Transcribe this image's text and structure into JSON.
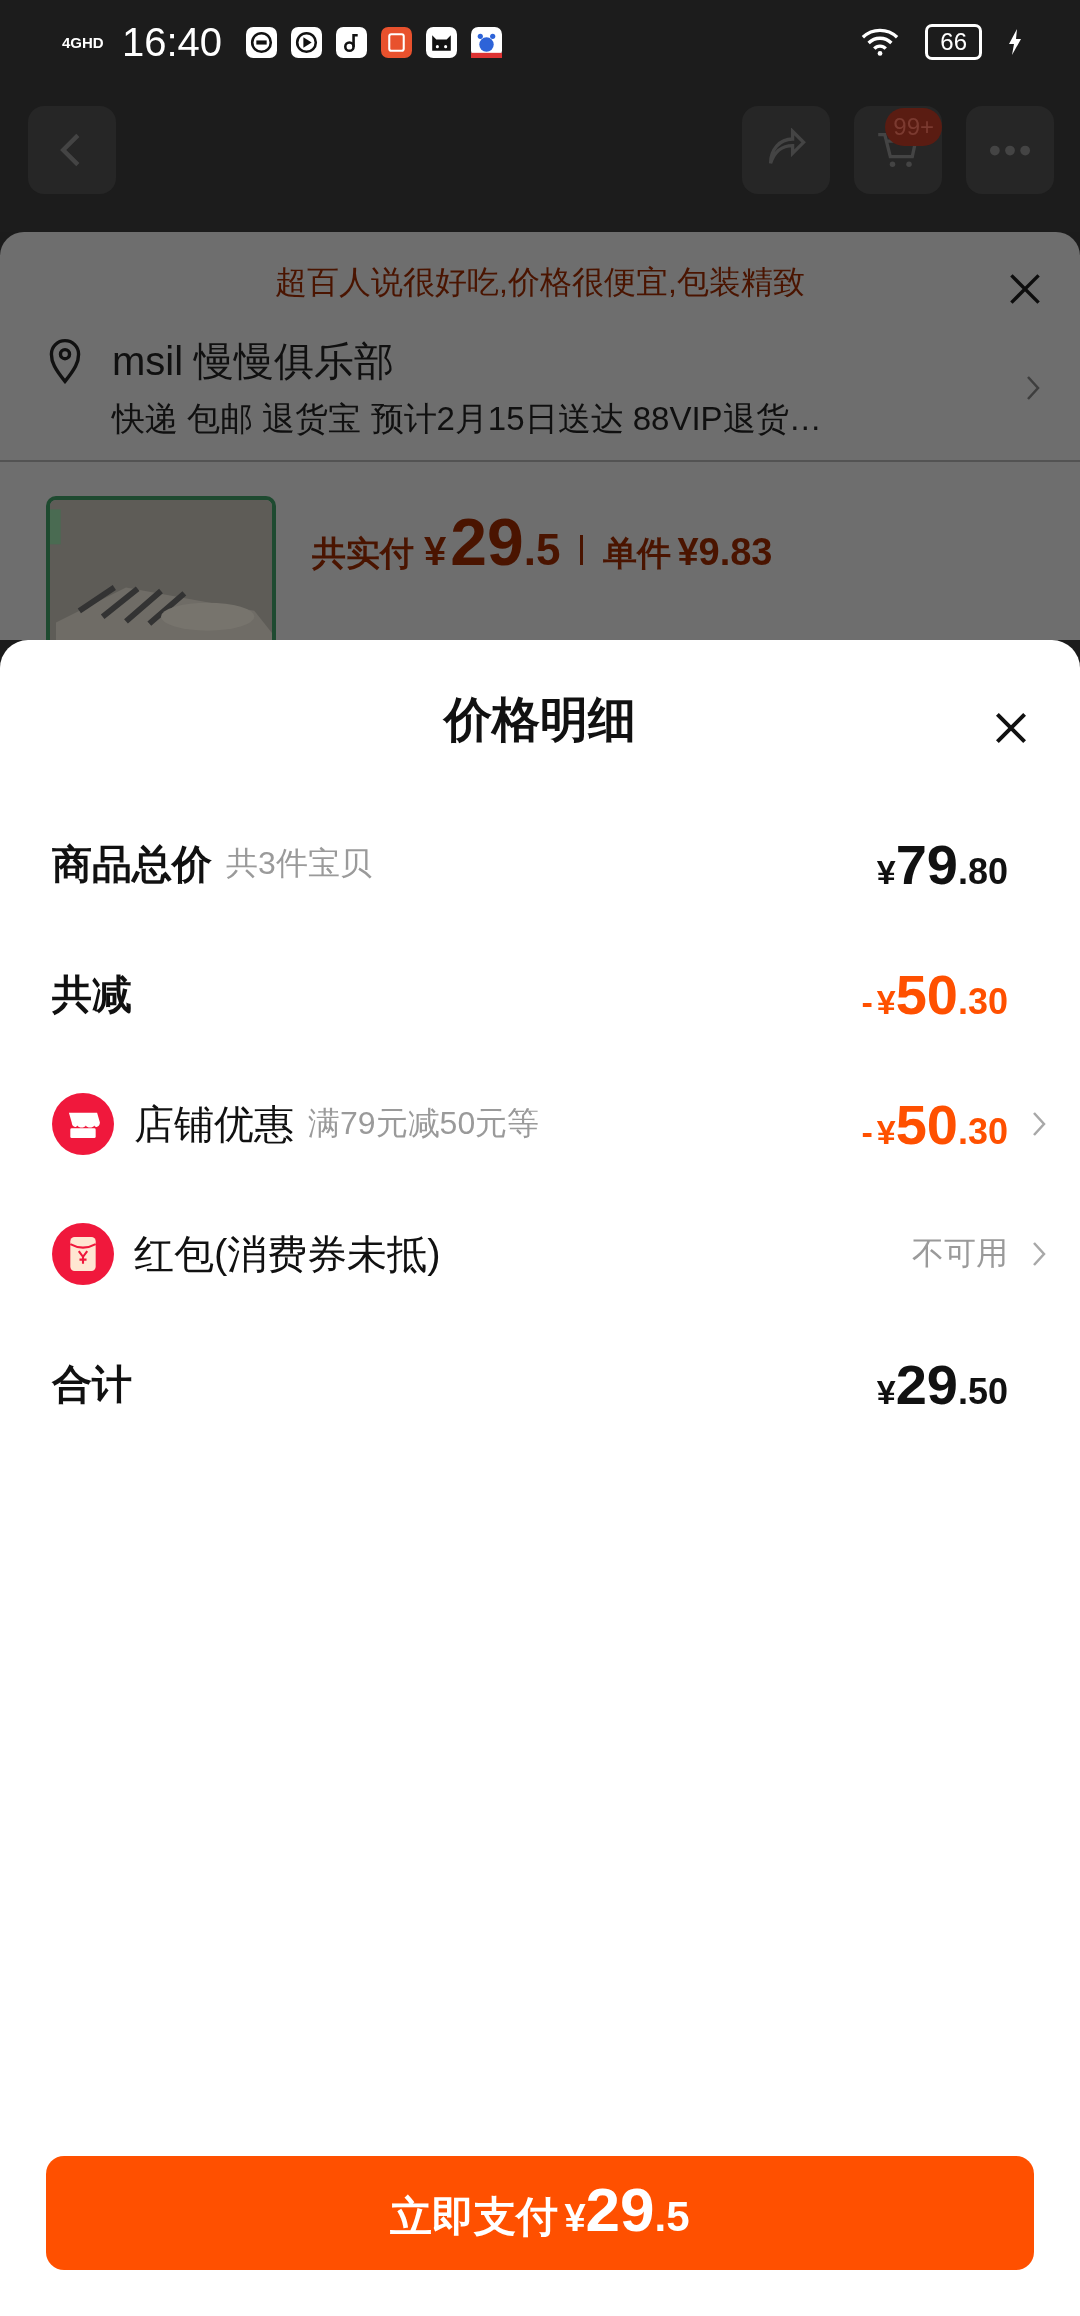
{
  "status_bar": {
    "network": "4GHD",
    "time": "16:40",
    "battery": "66"
  },
  "header": {
    "cart_badge": "99+"
  },
  "order_sheet": {
    "banner": "超百人说很好吃,价格很便宜,包装精致",
    "address": {
      "name": "msil 慢慢俱乐部",
      "details": "快递 包邮 退货宝 预计2月15日送达 88VIP退货…"
    },
    "product": {
      "paid_label": "共实付",
      "paid": {
        "currency": "¥",
        "integer": "29",
        "decimal": ".5"
      },
      "unit_label": "单件",
      "unit_price": "¥9.83"
    }
  },
  "price_details": {
    "title": "价格明细",
    "rows": [
      {
        "kind": "total",
        "label": "商品总价",
        "note": "共3件宝贝",
        "amount": {
          "currency": "¥",
          "integer": "79",
          "decimal": ".80"
        },
        "highlight": false,
        "link": false
      },
      {
        "kind": "total",
        "label": "共减",
        "amount": {
          "sign": "-",
          "currency": "¥",
          "integer": "50",
          "decimal": ".30"
        },
        "highlight": true,
        "link": false
      },
      {
        "kind": "store",
        "label": "店铺优惠",
        "note": "满79元减50元等",
        "amount": {
          "sign": "-",
          "currency": "¥",
          "integer": "50",
          "decimal": ".30"
        },
        "highlight": true,
        "link": true
      },
      {
        "kind": "packet",
        "label": "红包(消费券未抵)",
        "status": "不可用",
        "link": true
      },
      {
        "kind": "total",
        "label": "合计",
        "amount": {
          "currency": "¥",
          "integer": "29",
          "decimal": ".50"
        },
        "highlight": false,
        "link": false
      }
    ]
  },
  "pay_button": {
    "label": "立即支付",
    "currency": "¥",
    "integer": "29",
    "decimal": ".5"
  }
}
